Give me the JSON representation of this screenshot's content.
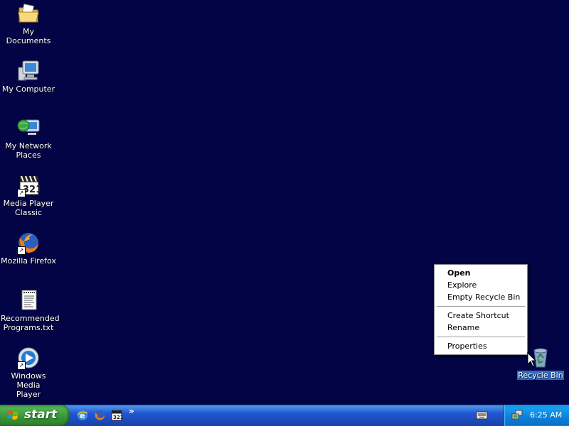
{
  "desktop": {
    "icons": [
      {
        "label_line1": "My Documents",
        "label_line2": ""
      },
      {
        "label_line1": "My Computer",
        "label_line2": ""
      },
      {
        "label_line1": "My Network",
        "label_line2": "Places"
      },
      {
        "label_line1": "Media Player",
        "label_line2": "Classic"
      },
      {
        "label_line1": "Mozilla Firefox",
        "label_line2": ""
      },
      {
        "label_line1": "Recommended",
        "label_line2": "Programs.txt"
      },
      {
        "label_line1": "Windows Media",
        "label_line2": "Player"
      },
      {
        "label_line1": "Recycle Bin",
        "label_line2": ""
      }
    ],
    "shortcut_arrow": "↗"
  },
  "context_menu": {
    "items": [
      {
        "label": "Open"
      },
      {
        "label": "Explore"
      },
      {
        "label": "Empty Recycle Bin"
      },
      {
        "label": "Create Shortcut"
      },
      {
        "label": "Rename"
      },
      {
        "label": "Properties"
      }
    ]
  },
  "taskbar": {
    "start_label": "start",
    "chevron": "»",
    "clock": "6:25 AM"
  },
  "colors": {
    "desktop_bg": "#020445",
    "selection": "#316ac5",
    "taskbar": "#2157d7",
    "start_button": "#389438",
    "tray": "#0c7fd8"
  }
}
